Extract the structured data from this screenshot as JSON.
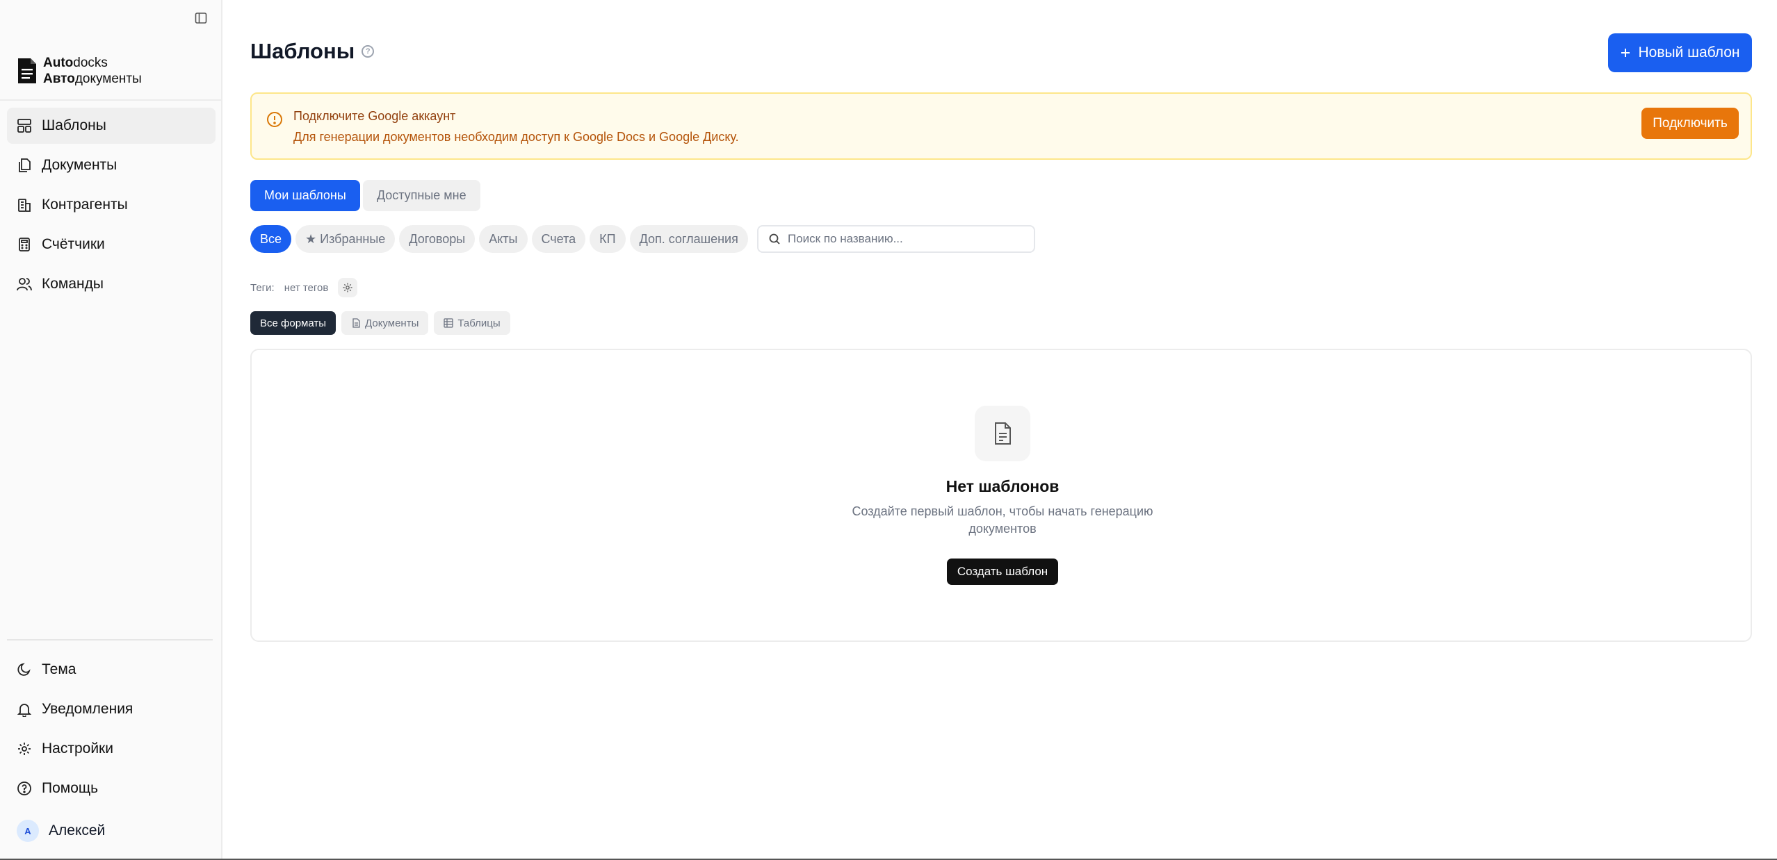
{
  "sidebar": {
    "brand": {
      "line1_bold": "Auto",
      "line1_rest": "docks",
      "line2_bold": "Авто",
      "line2_rest": "документы"
    },
    "nav": [
      {
        "label": "Шаблоны",
        "icon": "templates-icon",
        "active": true
      },
      {
        "label": "Документы",
        "icon": "documents-icon"
      },
      {
        "label": "Контрагенты",
        "icon": "building-icon"
      },
      {
        "label": "Счётчики",
        "icon": "calculator-icon"
      },
      {
        "label": "Команды",
        "icon": "users-icon"
      }
    ],
    "bottom": [
      {
        "label": "Тема",
        "icon": "moon-icon"
      },
      {
        "label": "Уведомления",
        "icon": "bell-icon"
      },
      {
        "label": "Настройки",
        "icon": "gear-icon"
      },
      {
        "label": "Помощь",
        "icon": "help-icon"
      }
    ],
    "user": {
      "initial": "А",
      "name": "Алексей"
    }
  },
  "header": {
    "title": "Шаблоны",
    "new_button": "Новый шаблон"
  },
  "alert": {
    "title": "Подключите Google аккаунт",
    "text": "Для генерации документов необходим доступ к Google Docs и Google Диску.",
    "button": "Подключить",
    "color": "#e8760b"
  },
  "tabs": [
    {
      "label": "Мои шаблоны",
      "active": true
    },
    {
      "label": "Доступные мне",
      "active": false
    }
  ],
  "filters": [
    "Все",
    "★ Избранные",
    "Договоры",
    "Акты",
    "Счета",
    "КП",
    "Доп. соглашения"
  ],
  "search": {
    "placeholder": "Поиск по названию..."
  },
  "tags": {
    "label": "Теги:",
    "value": "нет тегов"
  },
  "formats": [
    "Все форматы",
    "Документы",
    "Таблицы"
  ],
  "empty_state": {
    "title": "Нет шаблонов",
    "text": "Создайте первый шаблон, чтобы начать генерацию документов",
    "button": "Создать шаблон"
  },
  "colors": {
    "accent": "#1a5ff0",
    "warning_bg": "#fffbeb",
    "warning_text": "#b45309"
  }
}
